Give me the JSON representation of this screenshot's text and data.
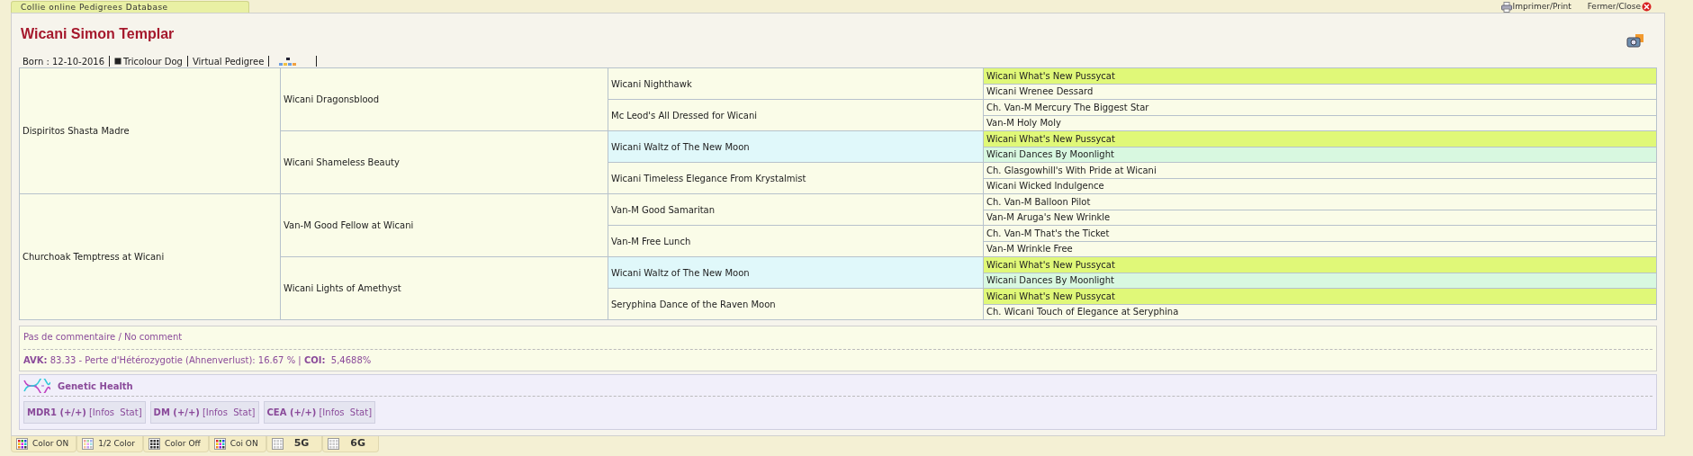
{
  "tab_title": "Collie online Pedigrees Database",
  "toolbar": [
    {
      "label": "Imprimer/Print"
    },
    {
      "label": "Fermer/Close"
    }
  ],
  "dog": {
    "name": "Wicani Simon Templar",
    "born": "Born : 12-10-2016",
    "coat": "Tricolour Dog",
    "virtual_pedigree": "Virtual Pedigree"
  },
  "pedigree": [
    {
      "name": "Dispiritos Shasta Madre",
      "color": "#fafce8",
      "children": [
        {
          "name": "Wicani Dragonsblood",
          "color": "#fafce8",
          "children": [
            {
              "name": "Wicani Nighthawk",
              "color": "#fafce8",
              "children": [
                {
                  "name": "Wicani What's New Pussycat",
                  "color": "#e0f878"
                },
                {
                  "name": "Wicani Wrenee Dessard",
                  "color": "#fafce8"
                }
              ]
            },
            {
              "name": "Mc Leod's All Dressed for Wicani",
              "color": "#fafce8",
              "children": [
                {
                  "name": "Ch. Van-M Mercury The Biggest Star",
                  "color": "#fafce8"
                },
                {
                  "name": "Van-M Holy Moly",
                  "color": "#fafce8"
                }
              ]
            }
          ]
        },
        {
          "name": "Wicani Shameless Beauty",
          "color": "#fafce8",
          "children": [
            {
              "name": "Wicani Waltz of The New Moon",
              "color": "#e0f8fa",
              "children": [
                {
                  "name": "Wicani What's New Pussycat",
                  "color": "#e0f878"
                },
                {
                  "name": "Wicani Dances By Moonlight",
                  "color": "#d8f8e0"
                }
              ]
            },
            {
              "name": "Wicani Timeless Elegance From Krystalmist",
              "color": "#fafce8",
              "children": [
                {
                  "name": "Ch. Glasgowhill's With Pride at Wicani",
                  "color": "#fafce8"
                },
                {
                  "name": "Wicani Wicked Indulgence",
                  "color": "#fafce8"
                }
              ]
            }
          ]
        }
      ]
    },
    {
      "name": "Churchoak Temptress at Wicani",
      "color": "#fafce8",
      "children": [
        {
          "name": "Van-M Good Fellow at Wicani",
          "color": "#fafce8",
          "children": [
            {
              "name": "Van-M Good Samaritan",
              "color": "#fafce8",
              "children": [
                {
                  "name": "Ch. Van-M Balloon Pilot",
                  "color": "#fafce8"
                },
                {
                  "name": "Van-M Aruga's New Wrinkle",
                  "color": "#fafce8"
                }
              ]
            },
            {
              "name": "Van-M Free Lunch",
              "color": "#fafce8",
              "children": [
                {
                  "name": "Ch. Van-M That's the Ticket",
                  "color": "#fafce8"
                },
                {
                  "name": "Van-M Wrinkle Free",
                  "color": "#fafce8"
                }
              ]
            }
          ]
        },
        {
          "name": "Wicani Lights of Amethyst",
          "color": "#fafce8",
          "children": [
            {
              "name": "Wicani Waltz of The New Moon",
              "color": "#e0f8fa",
              "children": [
                {
                  "name": "Wicani What's New Pussycat",
                  "color": "#e0f878"
                },
                {
                  "name": "Wicani Dances By Moonlight",
                  "color": "#d8f8e0"
                }
              ]
            },
            {
              "name": "Seryphina Dance of the Raven Moon",
              "color": "#fafce8",
              "children": [
                {
                  "name": "Wicani What's New Pussycat",
                  "color": "#e0f878"
                },
                {
                  "name": "Ch. Wicani Touch of Elegance at Seryphina",
                  "color": "#fafce8"
                }
              ]
            }
          ]
        }
      ]
    }
  ],
  "comment": "Pas de commentaire / No comment",
  "stats": "**AVK:** 83.33 - Perte d'Hétérozygotie (Ahnenverlust): 16.67 % | **COI:**  5,4688%",
  "genetic_health": {
    "title": "Genetic Health",
    "tests": [
      {
        "result": "MDR1 (+/+)",
        "info": "[Infos  Stat]"
      },
      {
        "result": "DM (+/+)",
        "info": "[Infos  Stat]"
      },
      {
        "result": "CEA (+/+)",
        "info": "[Infos  Stat]"
      }
    ]
  },
  "view_buttons": [
    {
      "label": "Color ON"
    },
    {
      "label": "1/2 Color"
    },
    {
      "label": "Color Off"
    },
    {
      "label": "Coi ON"
    },
    {
      "label": "5G"
    },
    {
      "label": "6G"
    }
  ]
}
